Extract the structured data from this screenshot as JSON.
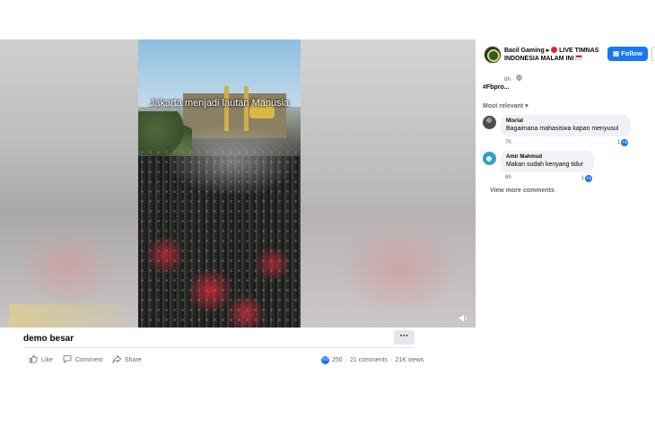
{
  "video": {
    "caption": "Jakarta menjadi lautan Manusia",
    "volume_icon": "speaker-icon"
  },
  "post": {
    "title": "demo besar",
    "more_label": "···",
    "actions": {
      "like": "Like",
      "comment": "Comment",
      "share": "Share"
    },
    "stats": {
      "reactions": "250",
      "comments": "21 comments",
      "separator": "·",
      "views": "21K views"
    }
  },
  "sidebar": {
    "page_name": "Bacil Gaming",
    "live_text": "LIVE TIMNAS INDONESIA MALAM INI",
    "time": "8h",
    "follow_label": "Follow",
    "hashtag": "#Fbpro...",
    "sort_label": "Most relevant",
    "comments": [
      {
        "author": "Misrial",
        "text": "Bagaimana mahasiswa kapan menyusul",
        "time": "7h",
        "reactions": "1"
      },
      {
        "author": "Amir Mahmud",
        "text": "Makan sudah kenyang tidur",
        "time": "6h",
        "reactions": "1"
      }
    ],
    "view_more": "View more comments"
  },
  "colors": {
    "accent": "#1877f2",
    "bubble": "#f0f2f5",
    "muted_text": "#65676b"
  }
}
